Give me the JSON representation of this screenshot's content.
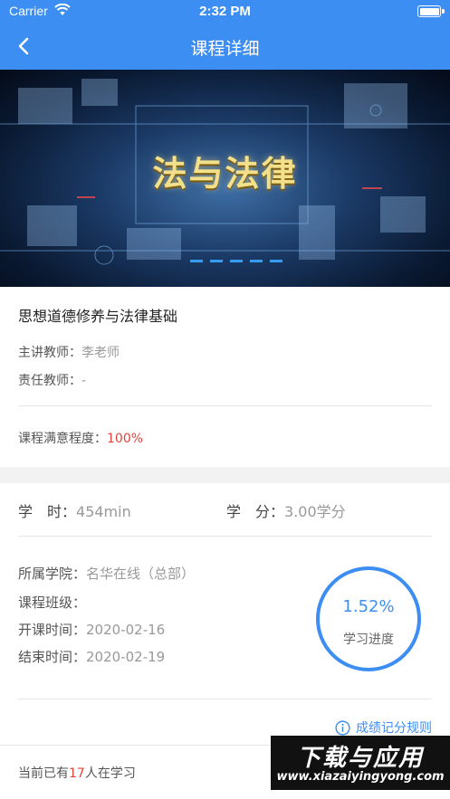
{
  "status_bar": {
    "carrier": "Carrier",
    "time": "2:32 PM"
  },
  "nav": {
    "title": "课程详细"
  },
  "banner": {
    "title": "法与法律"
  },
  "course": {
    "name": "思想道德修养与法律基础",
    "lecturer_label": "主讲教师：",
    "lecturer_value": "李老师",
    "responsible_label": "责任教师：",
    "responsible_value": "-",
    "satisfaction_label": "课程满意程度：",
    "satisfaction_value": "100%"
  },
  "hours": {
    "label": "学　时：",
    "value": "454min"
  },
  "credits": {
    "label": "学　分：",
    "value": "3.00学分"
  },
  "details": {
    "college_label": "所属学院：",
    "college_value": "名华在线（总部）",
    "class_label": "课程班级：",
    "class_value": "",
    "start_label": "开课时间：",
    "start_value": "2020-02-16",
    "end_label": "结束时间：",
    "end_value": "2020-02-19"
  },
  "progress": {
    "percent_text": "1.52%",
    "label": "学习进度",
    "value": 1.52
  },
  "rules_link": {
    "label": "成绩记分规则"
  },
  "learners": {
    "prefix": "当前已有",
    "count": "17",
    "suffix": "人在学习"
  },
  "watermark": {
    "title": "下载与应用",
    "url": "www.xiazaiyingyong.com"
  },
  "colors": {
    "accent": "#3d8ef2",
    "highlight": "#e0453c"
  }
}
